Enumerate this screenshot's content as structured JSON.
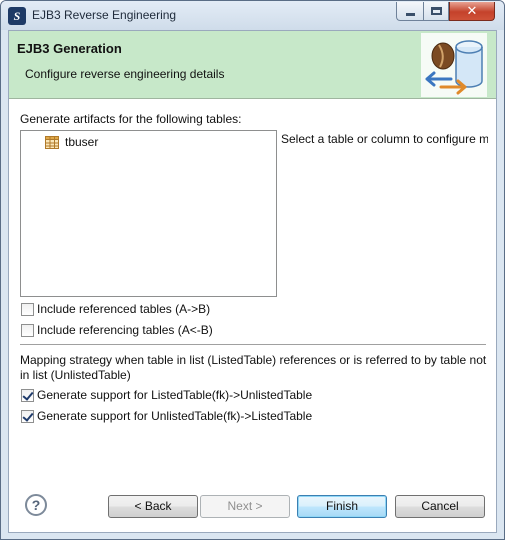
{
  "window": {
    "title": "EJB3 Reverse Engineering",
    "close_glyph": "✕"
  },
  "header": {
    "title": "EJB3 Generation",
    "description": "Configure reverse engineering details",
    "image_icon": "coffee-bean-database-icon"
  },
  "tables": {
    "label": "Generate artifacts for the following tables:",
    "items": [
      {
        "name": "tbuser",
        "icon": "table-icon"
      }
    ],
    "side_message": "Select a table or column to configure m"
  },
  "options": {
    "include_referenced": {
      "label": "Include referenced tables (A->B)",
      "checked": false
    },
    "include_referencing": {
      "label": "Include referencing tables (A<-B)",
      "checked": false
    }
  },
  "mapping": {
    "text": "Mapping strategy when table in list (ListedTable) references or is referred to by table not in list (UnlistedTable)",
    "listed_to_unlisted": {
      "label": "Generate support for ListedTable(fk)->UnlistedTable",
      "checked": true
    },
    "unlisted_to_listed": {
      "label": "Generate support for UnlistedTable(fk)->ListedTable",
      "checked": true
    }
  },
  "footer": {
    "help_glyph": "?",
    "back_label": "< Back",
    "next_label": "Next >",
    "finish_label": "Finish",
    "cancel_label": "Cancel"
  },
  "colors": {
    "header_bg": "#c7e8c9",
    "default_button_border": "#3c7fb1",
    "close_button": "#c4422b"
  }
}
